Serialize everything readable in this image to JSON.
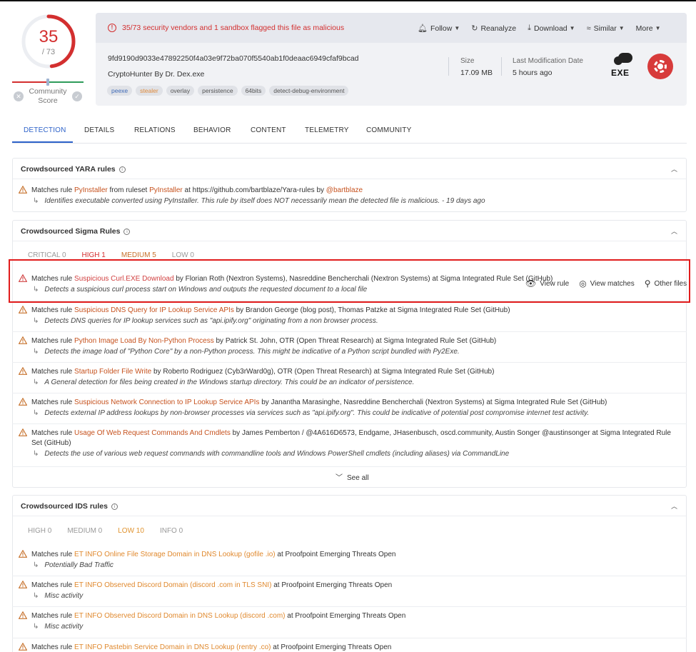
{
  "score": {
    "value": "35",
    "total": "/ 73",
    "community_label": [
      "Community",
      "Score"
    ]
  },
  "alert": {
    "text": "35/73 security vendors and 1 sandbox flagged this file as malicious"
  },
  "actions": [
    {
      "label": "Follow",
      "icon": "bell-icon",
      "glyph": "🔔︎",
      "caret": true
    },
    {
      "label": "Reanalyze",
      "icon": "refresh-icon",
      "glyph": "↻",
      "caret": false
    },
    {
      "label": "Download",
      "icon": "download-icon",
      "glyph": "⤓",
      "caret": true
    },
    {
      "label": "Similar",
      "icon": "similar-icon",
      "glyph": "≈",
      "caret": true
    },
    {
      "label": "More",
      "icon": "",
      "glyph": "",
      "caret": true
    }
  ],
  "file": {
    "hash": "9fd9190d9033e47892250f4a03e9f72ba070f5540ab1f0deaac6949cfaf9bcad",
    "name": "CryptoHunter By Dr. Dex.exe",
    "tags": [
      {
        "label": "peexe",
        "style": "blue"
      },
      {
        "label": "stealer",
        "style": "orange"
      },
      {
        "label": "overlay",
        "style": ""
      },
      {
        "label": "persistence",
        "style": ""
      },
      {
        "label": "64bits",
        "style": ""
      },
      {
        "label": "detect-debug-environment",
        "style": ""
      }
    ],
    "size_label": "Size",
    "size_value": "17.09 MB",
    "mod_label": "Last Modification Date",
    "mod_value": "5 hours ago",
    "type_label": "EXE"
  },
  "tabs": [
    "DETECTION",
    "DETAILS",
    "RELATIONS",
    "BEHAVIOR",
    "CONTENT",
    "TELEMETRY",
    "COMMUNITY"
  ],
  "yara": {
    "title": "Crowdsourced YARA rules",
    "item": {
      "pre": "Matches rule ",
      "rule": "PyInstaller",
      "mid": " from ruleset ",
      "ruleset": "PyInstaller",
      "post": " at https://github.com/bartblaze/Yara-rules by ",
      "author": "@bartblaze",
      "desc": "Identifies executable converted using PyInstaller. This rule by itself does NOT necessarily mean the detected file is malicious. - 19 days ago"
    }
  },
  "sigma": {
    "title": "Crowdsourced Sigma Rules",
    "filters": [
      {
        "label": "CRITICAL 0",
        "style": ""
      },
      {
        "label": "HIGH 1",
        "style": "high"
      },
      {
        "label": "MEDIUM 5",
        "style": "med"
      },
      {
        "label": "LOW 0",
        "style": ""
      }
    ],
    "row_actions": [
      {
        "label": "View rule",
        "icon": "eye-icon",
        "glyph": "👁︎"
      },
      {
        "label": "View matches",
        "icon": "target-icon",
        "glyph": "◎"
      },
      {
        "label": "Other files",
        "icon": "search-icon",
        "glyph": "⚲"
      }
    ],
    "items": [
      {
        "rule": "Suspicious Curl.EXE Download",
        "style": "red",
        "post": " by Florian Roth (Nextron Systems), Nasreddine Bencherchali (Nextron Systems) at Sigma Integrated Rule Set (GitHub)",
        "desc": "Detects a suspicious curl process start on Windows and outputs the requested document to a local file"
      },
      {
        "rule": "Suspicious DNS Query for IP Lookup Service APIs",
        "style": "",
        "post": " by Brandon George (blog post), Thomas Patzke at Sigma Integrated Rule Set (GitHub)",
        "desc": "Detects DNS queries for IP lookup services such as \"api.ipify.org\" originating from a non browser process."
      },
      {
        "rule": "Python Image Load By Non-Python Process",
        "style": "",
        "post": " by Patrick St. John, OTR (Open Threat Research) at Sigma Integrated Rule Set (GitHub)",
        "desc": "Detects the image load of \"Python Core\" by a non-Python process. This might be indicative of a Python script bundled with Py2Exe."
      },
      {
        "rule": "Startup Folder File Write",
        "style": "",
        "post": " by Roberto Rodriguez (Cyb3rWard0g), OTR (Open Threat Research) at Sigma Integrated Rule Set (GitHub)",
        "desc": "A General detection for files being created in the Windows startup directory. This could be an indicator of persistence."
      },
      {
        "rule": "Suspicious Network Connection to IP Lookup Service APIs",
        "style": "",
        "post": " by Janantha Marasinghe, Nasreddine Bencherchali (Nextron Systems) at Sigma Integrated Rule Set (GitHub)",
        "desc": "Detects external IP address lookups by non-browser processes via services such as \"api.ipify.org\". This could be indicative of potential post compromise internet test activity."
      },
      {
        "rule": "Usage Of Web Request Commands And Cmdlets",
        "style": "",
        "post": " by James Pemberton / @4A616D6573, Endgame, JHasenbusch, oscd.community, Austin Songer @austinsonger at Sigma Integrated Rule Set (GitHub)",
        "desc": "Detects the use of various web request commands with commandline tools and Windows PowerShell cmdlets (including aliases) via CommandLine"
      }
    ],
    "see_all": "See all"
  },
  "ids": {
    "title": "Crowdsourced IDS rules",
    "filters": [
      {
        "label": "HIGH 0",
        "style": ""
      },
      {
        "label": "MEDIUM 0",
        "style": ""
      },
      {
        "label": "LOW 10",
        "style": "low"
      },
      {
        "label": "INFO 0",
        "style": ""
      }
    ],
    "items": [
      {
        "rule": "ET INFO Online File Storage Domain in DNS Lookup (gofile .io)",
        "post": " at Proofpoint Emerging Threats Open",
        "desc": "Potentially Bad Traffic"
      },
      {
        "rule": "ET INFO Observed Discord Domain (discord .com in TLS SNI)",
        "post": " at Proofpoint Emerging Threats Open",
        "desc": "Misc activity"
      },
      {
        "rule": "ET INFO Observed Discord Domain in DNS Lookup (discord .com)",
        "post": " at Proofpoint Emerging Threats Open",
        "desc": "Misc activity"
      },
      {
        "rule": "ET INFO Pastebin Service Domain in DNS Lookup (rentry .co)",
        "post": " at Proofpoint Emerging Threats Open",
        "desc": ""
      }
    ]
  },
  "common": {
    "matches_prefix": "Matches rule "
  },
  "colors": {
    "accent": "#2e63c9",
    "danger": "#d32f2f",
    "warning": "#e0932f"
  }
}
